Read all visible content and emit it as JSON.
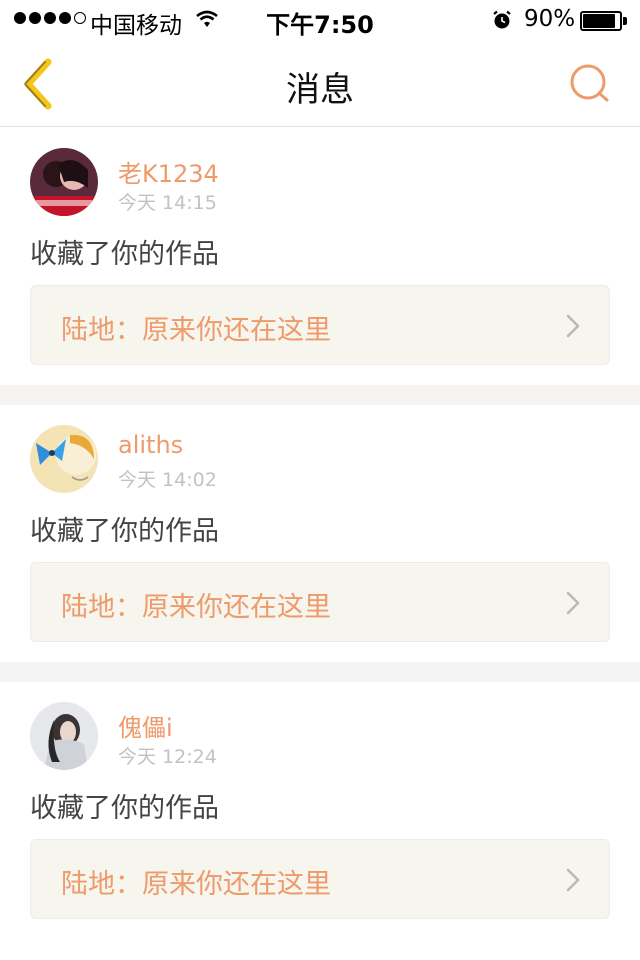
{
  "status_bar": {
    "carrier": "中国移动",
    "time": "下午7:50",
    "battery_percent_label": "90%",
    "battery_level": 0.9,
    "signal_bars_filled": 4,
    "signal_bars_total": 5
  },
  "nav": {
    "title": "消息",
    "back_icon": "chevron-left-icon",
    "search_icon": "search-icon",
    "accent_color": "#ee9a6a",
    "back_color": "#f5c518"
  },
  "messages": [
    {
      "username": "老K1234",
      "time": "今天 14:15",
      "action": "收藏了你的作品",
      "work": "陆地：原来你还在这里"
    },
    {
      "username": "aliths",
      "time": "今天 14:02",
      "action": "收藏了你的作品",
      "work": "陆地：原来你还在这里"
    },
    {
      "username": "傀儡i",
      "time": "今天 12:24",
      "action": "收藏了你的作品",
      "work": "陆地：原来你还在这里"
    }
  ]
}
